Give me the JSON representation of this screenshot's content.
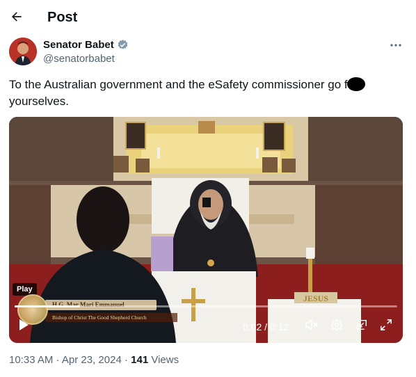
{
  "header": {
    "back_icon": "arrow-left-icon",
    "title": "Post"
  },
  "author": {
    "name": "Senator Babet",
    "handle": "@senatorbabet",
    "verified_icon": "verified-badge-icon",
    "verified_color": "#1d9bf0"
  },
  "tweet": {
    "text_line1": "To the Australian government and the eSafety commissioner go f",
    "text_line2": "yourselves."
  },
  "video": {
    "badge": "Play",
    "lower_third_name": "H.G. Mar Mari Emmanuel",
    "lower_third_subtitle": "Bishop of Christ The Good Shepherd Church",
    "altar_text": "JESUS",
    "elapsed": "0:02",
    "separator": " / ",
    "duration": "0:12",
    "progress_fraction": 0.17
  },
  "meta": {
    "time": "10:33 AM",
    "dot1": " · ",
    "date": "Apr 23, 2024",
    "dot2": " · ",
    "views_count": "141",
    "views_label": " Views"
  }
}
